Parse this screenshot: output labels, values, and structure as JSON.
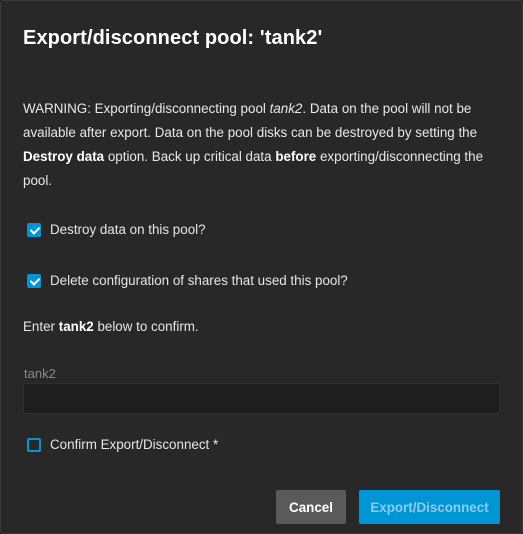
{
  "dialog": {
    "title": "Export/disconnect pool: 'tank2'",
    "warning": {
      "part1": "WARNING: Exporting/disconnecting pool ",
      "pool_name": "tank2",
      "part2": ". Data on the pool will not be available after export. Data on the pool disks can be destroyed by setting the ",
      "bold1": "Destroy data",
      "part3": " option. Back up critical data ",
      "bold2": "before",
      "part4": " exporting/disconnecting the pool."
    },
    "destroy_data": {
      "label": "Destroy data on this pool?",
      "checked": true
    },
    "delete_shares": {
      "label": "Delete configuration of shares that used this pool?",
      "checked": true
    },
    "confirm_text": {
      "prefix": "Enter ",
      "name": "tank2",
      "suffix": " below to confirm."
    },
    "confirm_input": {
      "placeholder": "tank2",
      "value": ""
    },
    "confirm_checkbox": {
      "label": "Confirm Export/Disconnect *",
      "checked": false
    },
    "buttons": {
      "cancel": "Cancel",
      "export": "Export/Disconnect"
    }
  },
  "colors": {
    "accent": "#0095d5",
    "background": "#282828",
    "cancel_button": "#5a5a5a"
  }
}
